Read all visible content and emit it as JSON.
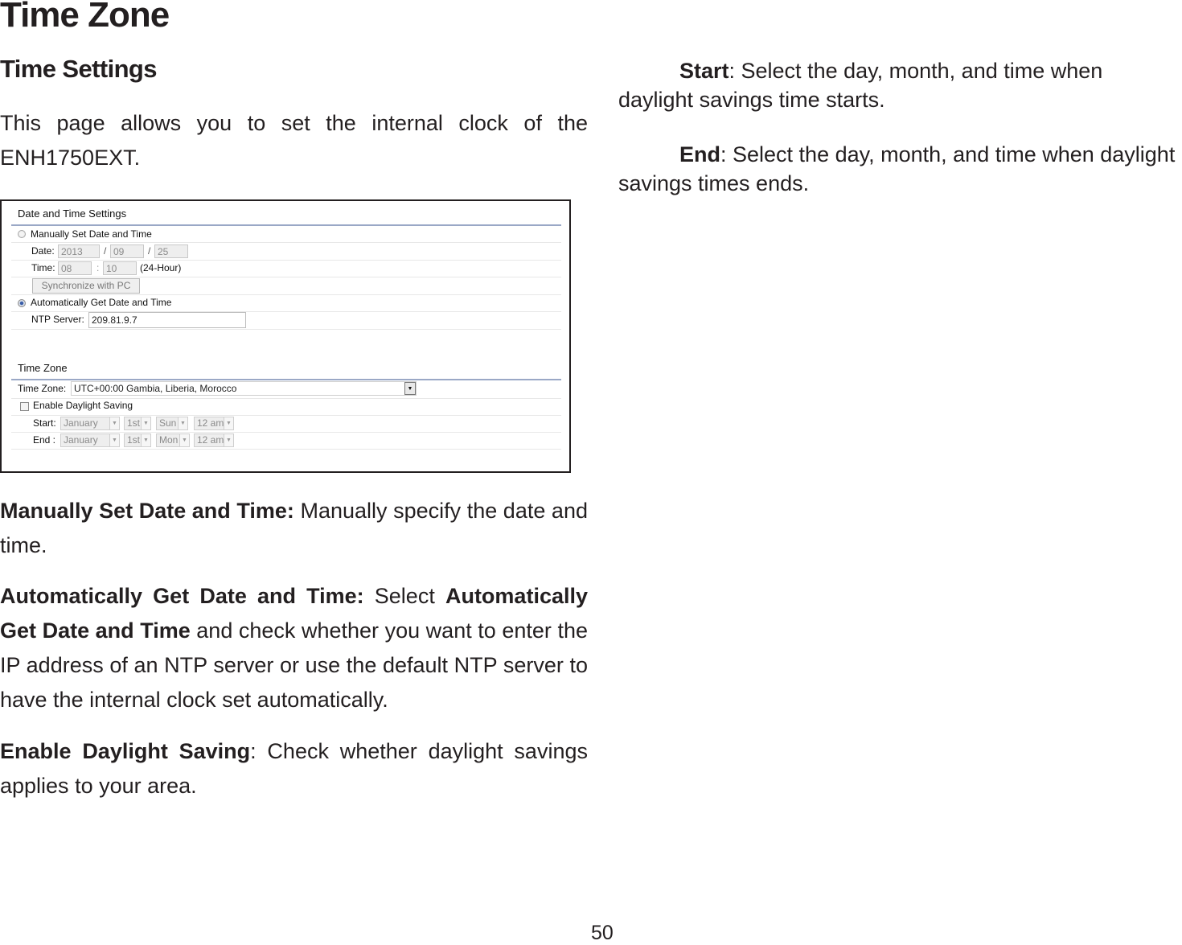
{
  "page": {
    "title": "Time Zone",
    "section_title": "Time Settings",
    "intro": "This page allows you to set the internal clock of the ENH1750EXT.",
    "page_number": "50"
  },
  "descriptions": {
    "manual": {
      "term": "Manually Set Date and Time:",
      "text": " Manually specify the date and time."
    },
    "auto": {
      "term": "Automatically Get Date and Time:",
      "text_before": " Select ",
      "term2": "Automatically Get Date and Time",
      "text_after": " and check whether you want to enter the IP address of an NTP server or use the default NTP server to have the internal clock set automatically."
    },
    "daylight": {
      "term": "Enable Daylight Saving",
      "text": ": Check whether daylight savings applies to your area."
    },
    "start": {
      "term": "Start",
      "text": ": Select the day, month, and time when daylight savings time starts."
    },
    "end": {
      "term": "End",
      "text": ": Select the day, month, and time when daylight savings times ends."
    }
  },
  "screenshot": {
    "date_time_header": "Date and Time Settings",
    "manual_option": {
      "label": "Manually Set Date and Time",
      "selected": false
    },
    "date_label": "Date:",
    "date_year": "2013",
    "date_sep": "/",
    "date_month": "09",
    "date_day": "25",
    "time_label": "Time:",
    "time_hour": "08",
    "time_sep": ":",
    "time_minute": "10",
    "time_format": "(24-Hour)",
    "sync_button": "Synchronize with PC",
    "auto_option": {
      "label": "Automatically Get Date and Time",
      "selected": true
    },
    "ntp_label": "NTP Server:",
    "ntp_value": "209.81.9.7",
    "time_zone_header": "Time Zone",
    "time_zone_label": "Time Zone:",
    "time_zone_value": "UTC+00:00 Gambia, Liberia, Morocco",
    "daylight_checkbox": {
      "label": "Enable Daylight Saving",
      "checked": false
    },
    "start": {
      "label": "Start:",
      "month": "January",
      "week": "1st",
      "day": "Sun",
      "hour": "12 am"
    },
    "end": {
      "label": "End :",
      "month": "January",
      "week": "1st",
      "day": "Mon",
      "hour": "12 am"
    }
  }
}
